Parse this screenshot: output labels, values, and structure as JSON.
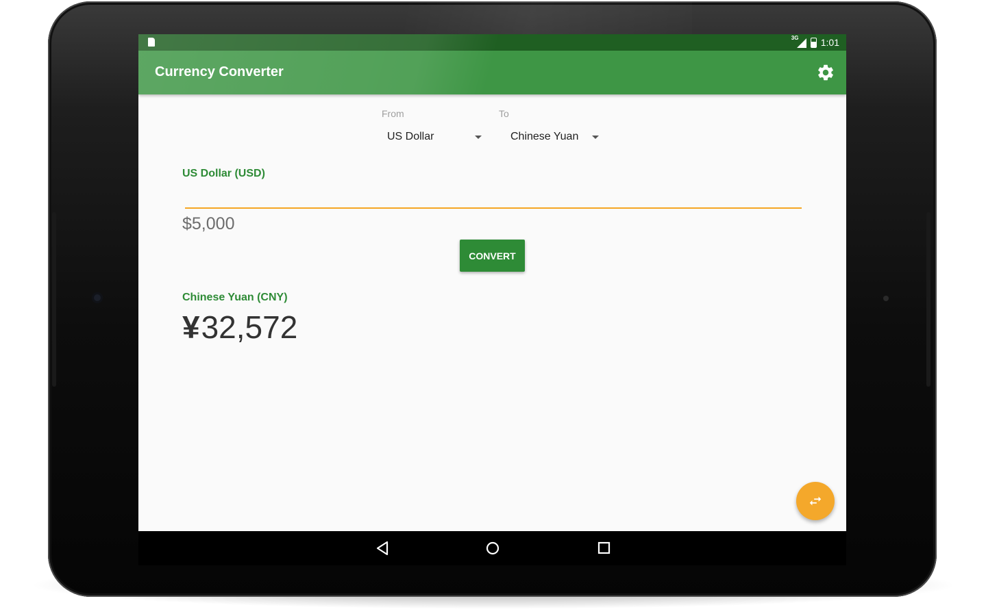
{
  "status_bar": {
    "network_label": "3G",
    "time": "1:01"
  },
  "app_bar": {
    "title": "Currency Converter",
    "settings_icon": "gear-icon"
  },
  "selectors": {
    "from_label": "From",
    "to_label": "To",
    "from_value": "US Dollar",
    "to_value": "Chinese Yuan"
  },
  "input": {
    "title": "US Dollar (USD)",
    "symbol": "$",
    "amount": "5,000"
  },
  "convert_button": {
    "label": "CONVERT"
  },
  "output": {
    "title": "Chinese Yuan (CNY)",
    "symbol": "¥",
    "amount": "32,572"
  },
  "fab": {
    "icon": "swap-icon"
  },
  "colors": {
    "primary": "#3e9645",
    "primary_dark": "#1f5f22",
    "accent": "#f4a82b",
    "button": "#2e8b36"
  }
}
